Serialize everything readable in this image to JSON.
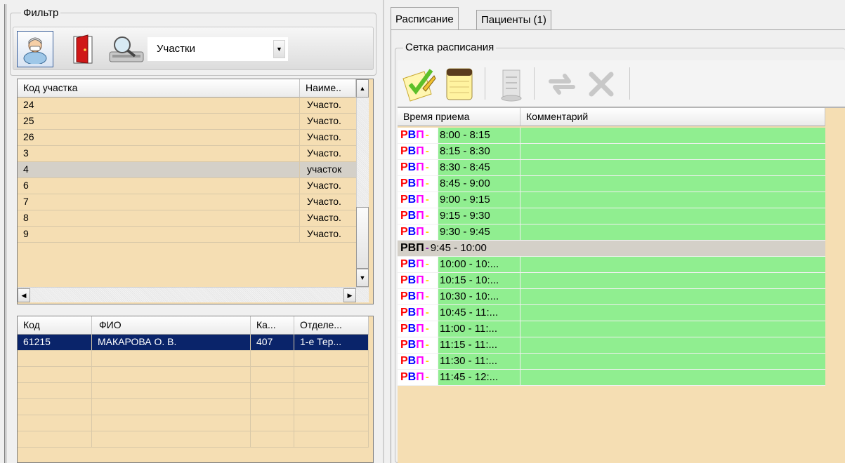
{
  "filter": {
    "legend": "Фильтр",
    "combo_value": "Участки"
  },
  "upper_grid": {
    "columns": [
      "Код участка",
      "Наиме.."
    ],
    "rows": [
      {
        "code": "24",
        "name": "Участо."
      },
      {
        "code": "25",
        "name": "Участо."
      },
      {
        "code": "26",
        "name": "Участо."
      },
      {
        "code": "3",
        "name": "Участо."
      },
      {
        "code": "4",
        "name": "участок"
      },
      {
        "code": "6",
        "name": "Участо."
      },
      {
        "code": "7",
        "name": "Участо."
      },
      {
        "code": "8",
        "name": "Участо."
      },
      {
        "code": "9",
        "name": "Участо."
      }
    ],
    "selected_index": 4
  },
  "lower_grid": {
    "columns": [
      "Код",
      "ФИО",
      "Ка...",
      "Отделе..."
    ],
    "rows": [
      {
        "code": "61215",
        "fio": "МАКАРОВА О. В.",
        "cab": "407",
        "dept": "1-е Тер..."
      }
    ]
  },
  "tabs": [
    {
      "label": "Расписание",
      "active": true
    },
    {
      "label": "Пациенты (1)",
      "active": false
    }
  ],
  "schedule": {
    "legend": "Сетка расписания",
    "columns": [
      "Время приема",
      "Комментарий"
    ],
    "prefix": {
      "r": "Р",
      "v": "В",
      "p": "П",
      "dash": "-"
    },
    "rows": [
      {
        "time": "8:00 - 8:15",
        "comment": "",
        "state": "free"
      },
      {
        "time": "8:15 - 8:30",
        "comment": "",
        "state": "free"
      },
      {
        "time": "8:30 - 8:45",
        "comment": "",
        "state": "free"
      },
      {
        "time": "8:45 - 9:00",
        "comment": "",
        "state": "free"
      },
      {
        "time": "9:00 - 9:15",
        "comment": "",
        "state": "free"
      },
      {
        "time": "9:15 - 9:30",
        "comment": "",
        "state": "free"
      },
      {
        "time": "9:30 - 9:45",
        "comment": "",
        "state": "free"
      },
      {
        "time": "9:45 - 10:00",
        "comment": "",
        "state": "selected"
      },
      {
        "time": "10:00 - 10:...",
        "comment": "",
        "state": "free"
      },
      {
        "time": "10:15 - 10:...",
        "comment": "",
        "state": "free"
      },
      {
        "time": "10:30 - 10:...",
        "comment": "",
        "state": "free"
      },
      {
        "time": "10:45 - 11:...",
        "comment": "",
        "state": "free"
      },
      {
        "time": "11:00 - 11:...",
        "comment": "",
        "state": "free"
      },
      {
        "time": "11:15 - 11:...",
        "comment": "",
        "state": "free"
      },
      {
        "time": "11:30 - 11:...",
        "comment": "",
        "state": "free"
      },
      {
        "time": "11:45 - 12:...",
        "comment": "",
        "state": "free"
      }
    ]
  },
  "colors": {
    "free_slot": "#90ee90",
    "selected_slot": "#d4d0c8",
    "grid_bg": "#f5deb3",
    "selection_bg": "#0a246a"
  },
  "icons": {
    "filter_doctor": "doctor-icon",
    "filter_cabinet": "door-icon",
    "filter_search": "search-scanner-icon",
    "schedule_toolbar": [
      "edit-notebook-icon",
      "notepad-icon",
      "scroll-icon",
      "refresh-icon",
      "delete-icon"
    ]
  }
}
